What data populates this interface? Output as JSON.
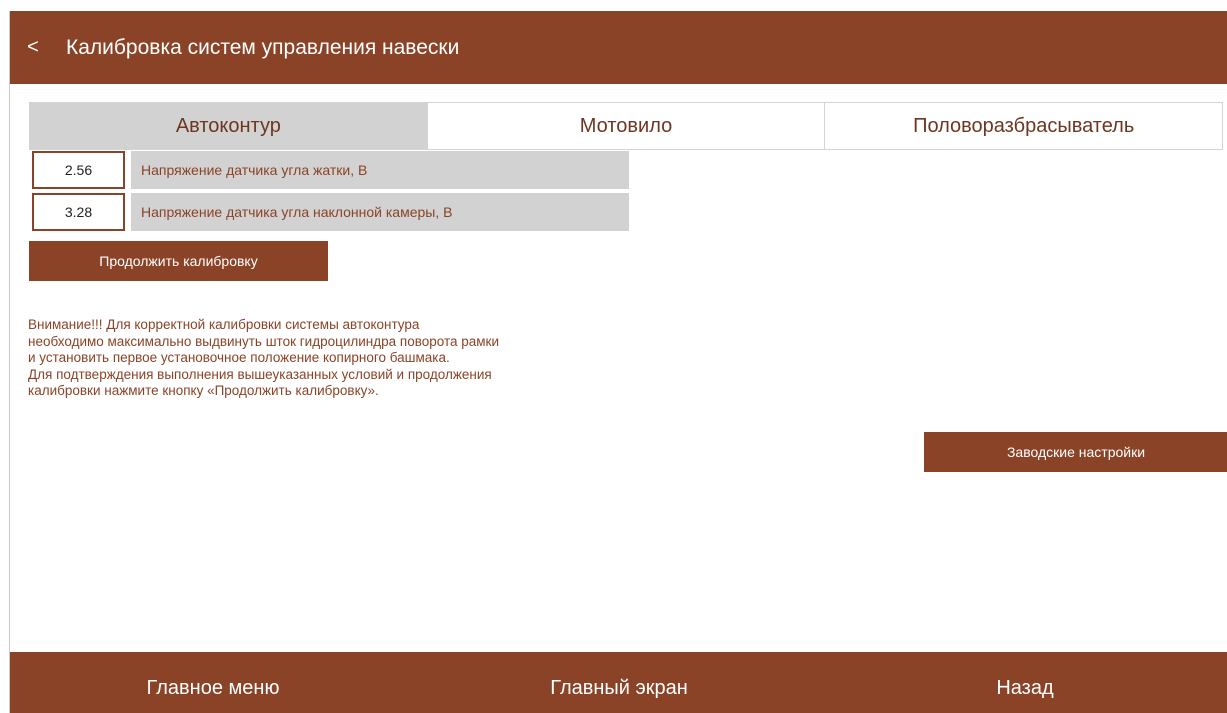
{
  "header": {
    "back_label": "<",
    "title": "Калибровка систем управления навески"
  },
  "tabs": [
    {
      "label": "Автоконтур",
      "active": true
    },
    {
      "label": "Мотовило",
      "active": false
    },
    {
      "label": "Половоразбрасыватель",
      "active": false
    }
  ],
  "params": [
    {
      "value": "2.56",
      "label": "Напряжение датчика угла жатки, В"
    },
    {
      "value": "3.28",
      "label": "Напряжение датчика угла наклонной камеры, В"
    }
  ],
  "continue_button": "Продолжить калибровку",
  "warning_lines": [
    "Внимание!!! Для корректной калибровки системы автоконтура",
    "необходимо максимально выдвинуть шток гидроцилиндра поворота рамки",
    "и установить первое установочное положение копирного башмака.",
    "Для подтверждения выполнения вышеуказанных условий и продолжения",
    "калибровки нажмите кнопку «Продолжить калибровку»."
  ],
  "factory_button": "Заводские настройки",
  "footer": {
    "main_menu": "Главное меню",
    "main_screen": "Главный экран",
    "back": "Назад"
  },
  "colors": {
    "accent": "#8b4327",
    "tab_active_bg": "#d2d2d2",
    "label_bg": "#d2d2d2"
  }
}
